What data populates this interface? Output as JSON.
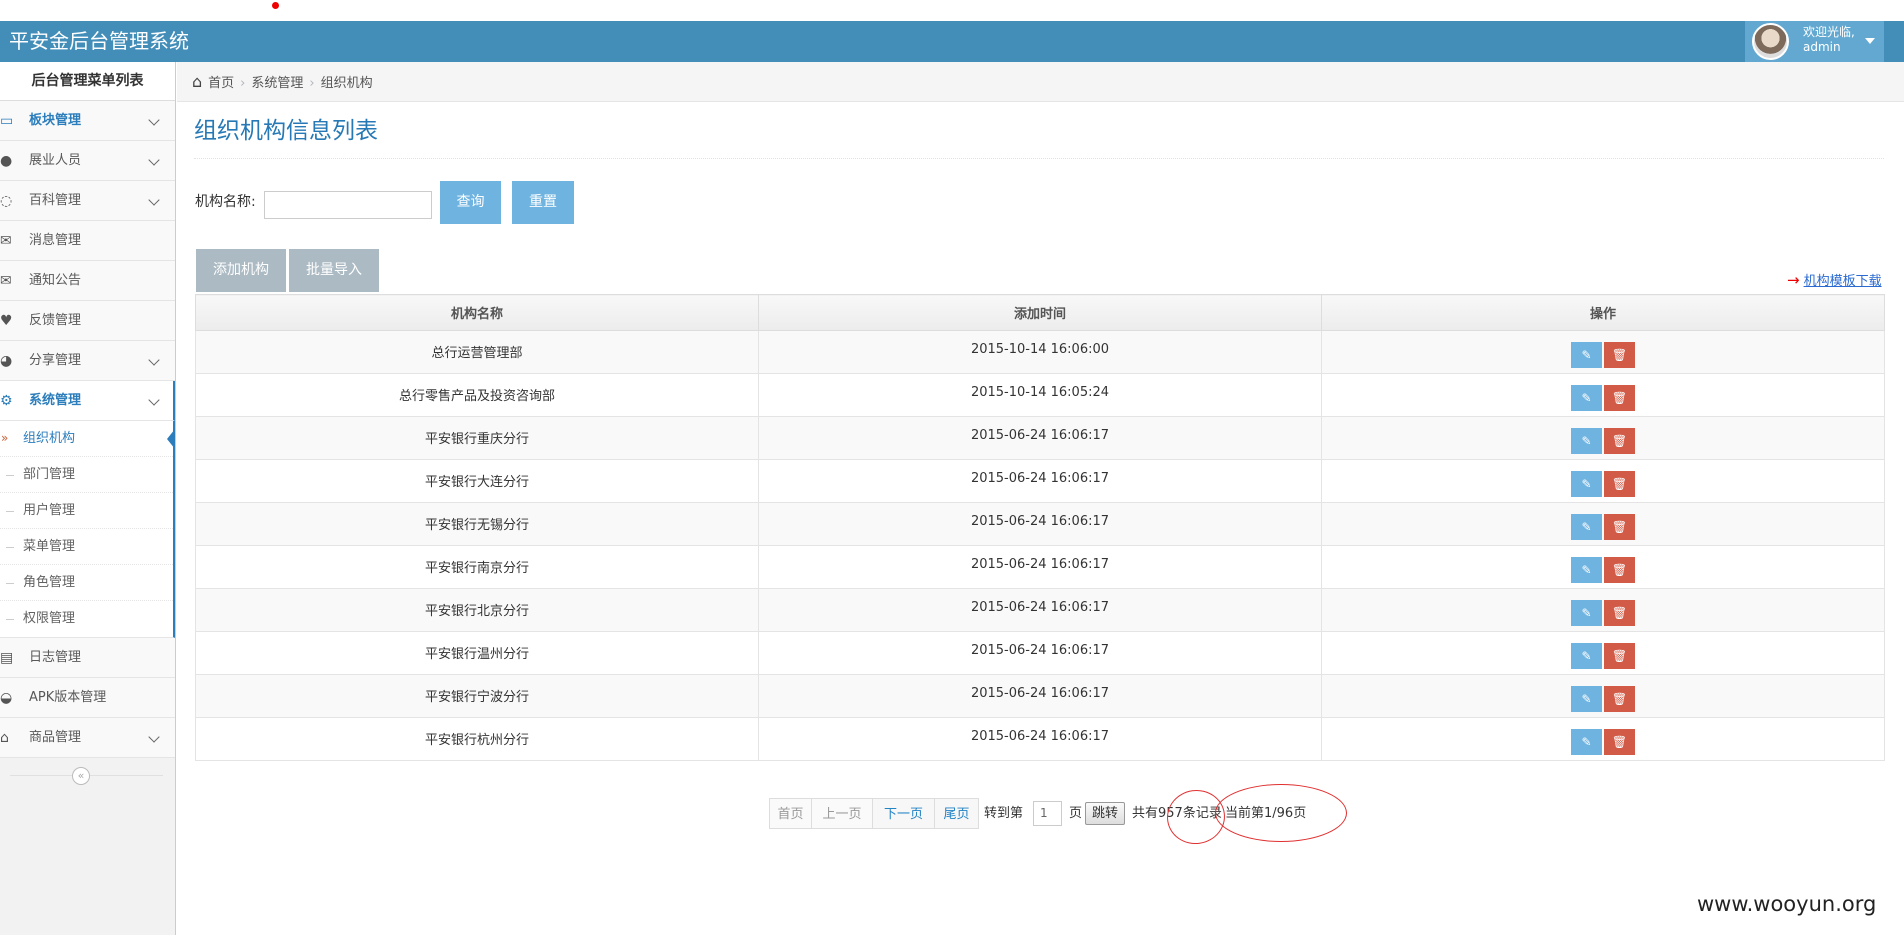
{
  "app": {
    "title": "平安金后台管理系统"
  },
  "user": {
    "welcome": "欢迎光临,",
    "name": "admin"
  },
  "sidebar": {
    "title": "后台管理菜单列表",
    "items": [
      {
        "label": "板块管理",
        "icon": "monitor-icon",
        "glyph": "▭"
      },
      {
        "label": "展业人员",
        "icon": "users-icon",
        "glyph": "●"
      },
      {
        "label": "百科管理",
        "icon": "comments-icon",
        "glyph": "◌"
      },
      {
        "label": "消息管理",
        "icon": "envelope-icon",
        "glyph": "✉"
      },
      {
        "label": "通知公告",
        "icon": "envelope-icon",
        "glyph": "✉"
      },
      {
        "label": "反馈管理",
        "icon": "heart-icon",
        "glyph": "♥"
      },
      {
        "label": "分享管理",
        "icon": "dashboard-icon",
        "glyph": "◕"
      },
      {
        "label": "系统管理",
        "icon": "gear-icon",
        "glyph": "⚙"
      },
      {
        "label": "日志管理",
        "icon": "book-icon",
        "glyph": "▤"
      },
      {
        "label": "APK版本管理",
        "icon": "inbox-icon",
        "glyph": "◒"
      },
      {
        "label": "商品管理",
        "icon": "home-icon",
        "glyph": "⌂"
      }
    ],
    "submenu": [
      {
        "label": "组织机构"
      },
      {
        "label": "部门管理"
      },
      {
        "label": "用户管理"
      },
      {
        "label": "菜单管理"
      },
      {
        "label": "角色管理"
      },
      {
        "label": "权限管理"
      }
    ],
    "collapse_glyph": "«"
  },
  "breadcrumb": {
    "home": "首页",
    "section": "系统管理",
    "current": "组织机构"
  },
  "page": {
    "title": "组织机构信息列表"
  },
  "search": {
    "label": "机构名称:",
    "value": "",
    "query_button": "查询",
    "reset_button": "重置"
  },
  "actions": {
    "add_button": "添加机构",
    "import_button": "批量导入",
    "template_link": "机构模板下载",
    "arrow": "→"
  },
  "table": {
    "columns": [
      "机构名称",
      "添加时间",
      "操作"
    ],
    "rows": [
      {
        "name": "总行运营管理部",
        "time": "2015-10-14 16:06:00"
      },
      {
        "name": "总行零售产品及投资咨询部",
        "time": "2015-10-14 16:05:24"
      },
      {
        "name": "平安银行重庆分行",
        "time": "2015-06-24 16:06:17"
      },
      {
        "name": "平安银行大连分行",
        "time": "2015-06-24 16:06:17"
      },
      {
        "name": "平安银行无锡分行",
        "time": "2015-06-24 16:06:17"
      },
      {
        "name": "平安银行南京分行",
        "time": "2015-06-24 16:06:17"
      },
      {
        "name": "平安银行北京分行",
        "time": "2015-06-24 16:06:17"
      },
      {
        "name": "平安银行温州分行",
        "time": "2015-06-24 16:06:17"
      },
      {
        "name": "平安银行宁波分行",
        "time": "2015-06-24 16:06:17"
      },
      {
        "name": "平安银行杭州分行",
        "time": "2015-06-24 16:06:17"
      }
    ],
    "edit_glyph": "✎",
    "delete_glyph": "🗑"
  },
  "pager": {
    "first": "首页",
    "prev": "上一页",
    "next": "下一页",
    "last": "尾页",
    "goto_prefix": "转到第",
    "goto_value": "1",
    "goto_suffix": "页",
    "jump": "跳转",
    "total": "共有957条记录",
    "current": "当前第1/96页"
  },
  "watermark": "www.wooyun.org",
  "colors": {
    "navbar": "#438eb9",
    "accent": "#2b7dbc",
    "primary_button": "#6fb3e0",
    "danger_button": "#d15b47",
    "annotation": "#e03030"
  }
}
